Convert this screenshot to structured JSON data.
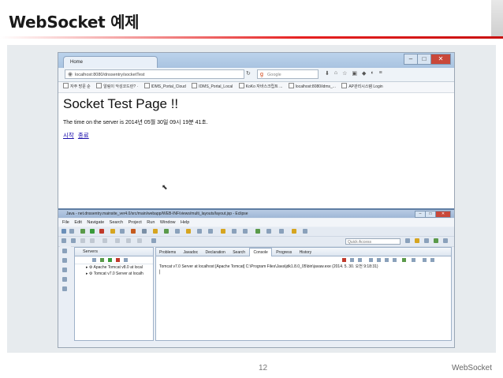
{
  "slide": {
    "title": "WebSocket 예제",
    "page_number": "12",
    "footer_label": "WebSocket"
  },
  "browser": {
    "tab_title": "Home",
    "url": "localhost:8080/dnssentry/socketTest",
    "search_placeholder": "Google",
    "bookmarks": [
      "자주 방문 순",
      "알림이 악성코드란? ·",
      "IDMS_Portal_Cloud",
      "IDMS_Portal_Local",
      "KoKo 자바스크립트 ...",
      "localhost:8080/idms_...",
      "AP관리시스템 Login"
    ],
    "page_heading": "Socket Test Page !!",
    "page_time_text": "The time on the server is 2014년 05월 30일 09시 19분 41초.",
    "links": [
      "시작",
      "종료"
    ]
  },
  "eclipse": {
    "window_title": "Java - net.dnssentry.mainsite_ver4.0/src/main/webapp/WEB-INF/views/multi_layouts/layout.jsp - Eclipse",
    "menu": [
      "File",
      "Edit",
      "Navigate",
      "Search",
      "Project",
      "Run",
      "Window",
      "Help"
    ],
    "quick_access_placeholder": "Quick Access",
    "servers_tab": "Servers",
    "servers": [
      "Apache Tomcat v8.0 at local",
      "Tomcat v7.0 Server at localh"
    ],
    "console_tabs": [
      "Problems",
      "Javadoc",
      "Declaration",
      "Search",
      "Console",
      "Progress",
      "History"
    ],
    "active_console_tab": "Console",
    "console_line": "Tomcat v7.0 Server at localhost [Apache Tomcat] C:\\Program Files\\Java\\jdk1.8.0_05\\bin\\javaw.exe (2014. 5. 30. 오전 9:18:31)"
  },
  "colors": {
    "accent_red": "#e62020",
    "eclipse_border": "#5f7ea3",
    "link": "#1a0dab"
  }
}
